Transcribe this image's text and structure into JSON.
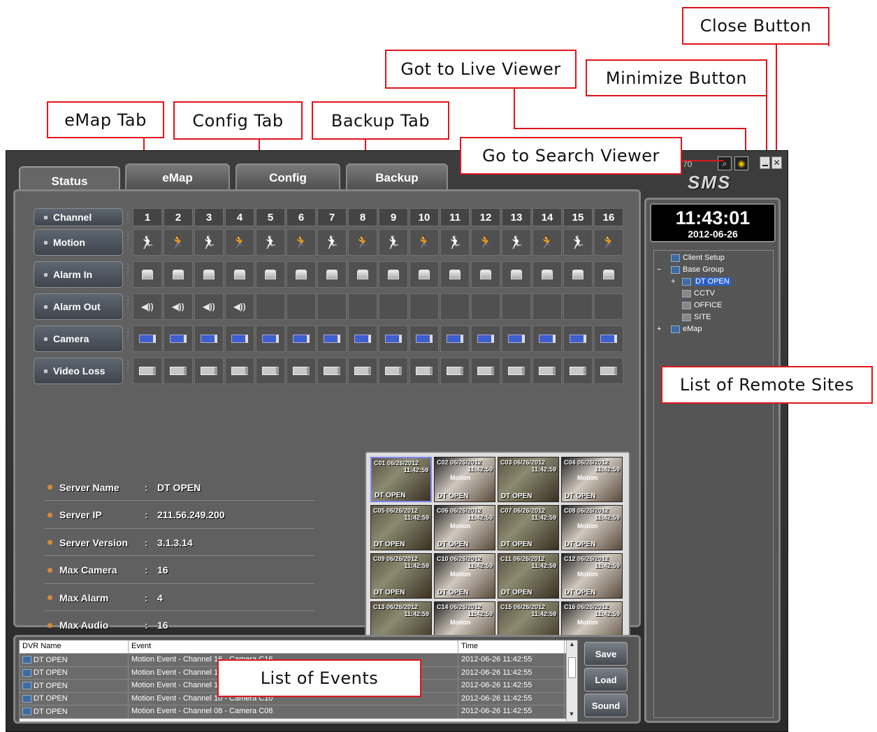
{
  "callouts": {
    "close": "Close Button",
    "live": "Got to Live Viewer",
    "minimize": "Minimize Button",
    "emap": "eMap Tab",
    "config": "Config Tab",
    "backup": "Backup Tab",
    "search": "Go to Search Viewer",
    "remote": "List of Remote Sites",
    "events": "List of Events"
  },
  "window": {
    "brand": "SMS",
    "version_fragment": "70"
  },
  "tabs": [
    "Status",
    "eMap",
    "Config",
    "Backup"
  ],
  "rows": [
    "Channel",
    "Motion",
    "Alarm In",
    "Alarm Out",
    "Camera",
    "Video Loss"
  ],
  "channels": [
    "1",
    "2",
    "3",
    "4",
    "5",
    "6",
    "7",
    "8",
    "9",
    "10",
    "11",
    "12",
    "13",
    "14",
    "15",
    "16"
  ],
  "server": [
    {
      "key": "Server Name",
      "value": "DT OPEN"
    },
    {
      "key": "Server IP",
      "value": "211.56.249.200"
    },
    {
      "key": "Server Version",
      "value": "3.1.3.14"
    },
    {
      "key": "Max Camera",
      "value": "16"
    },
    {
      "key": "Max Alarm",
      "value": "4"
    },
    {
      "key": "Max Audio",
      "value": "16"
    }
  ],
  "thumbnails": {
    "date": "06/26/2012",
    "time": "11:42:59",
    "site": "DT OPEN",
    "motion_label": "Motion",
    "ids": [
      "C01",
      "C02",
      "C03",
      "C04",
      "C05",
      "C06",
      "C07",
      "C08",
      "C09",
      "C10",
      "C11",
      "C12",
      "C13",
      "C14",
      "C15",
      "C16"
    ]
  },
  "clock": {
    "time": "11:43:01",
    "date": "2012-06-26"
  },
  "tree": {
    "client_setup": "Client Setup",
    "base_group": "Base Group",
    "items": [
      "DT OPEN",
      "CCTV",
      "OFFICE",
      "SITE"
    ],
    "emap": "eMap"
  },
  "events": {
    "headers": [
      "DVR Name",
      "Event",
      "Time"
    ],
    "rows": [
      {
        "dvr": "DT OPEN",
        "event": "Motion Event  -  Channel 16  -  Camera C16",
        "time": "2012-06-26 11:42:55"
      },
      {
        "dvr": "DT OPEN",
        "event": "Motion Event  -  Channel 14  -  Camera C14",
        "time": "2012-06-26 11:42:55"
      },
      {
        "dvr": "DT OPEN",
        "event": "Motion Event  -  Channel 12  -  Camera C12",
        "time": "2012-06-26 11:42:55"
      },
      {
        "dvr": "DT OPEN",
        "event": "Motion Event  -  Channel 10  -  Camera C10",
        "time": "2012-06-26 11:42:55"
      },
      {
        "dvr": "DT OPEN",
        "event": "Motion Event  -  Channel 08  -  Camera C08",
        "time": "2012-06-26 11:42:55"
      }
    ],
    "buttons": [
      "Save",
      "Load",
      "Sound"
    ]
  },
  "colors": {
    "motion_active": "#e23b3b",
    "accent": "#e0151b",
    "selected": "#2a62c9"
  },
  "icons": {
    "motion": "running-person-icon",
    "alarm_in": "sensor-icon",
    "alarm_out": "speaker-icon",
    "camera": "camera-icon",
    "video_loss": "camera-loss-icon"
  }
}
